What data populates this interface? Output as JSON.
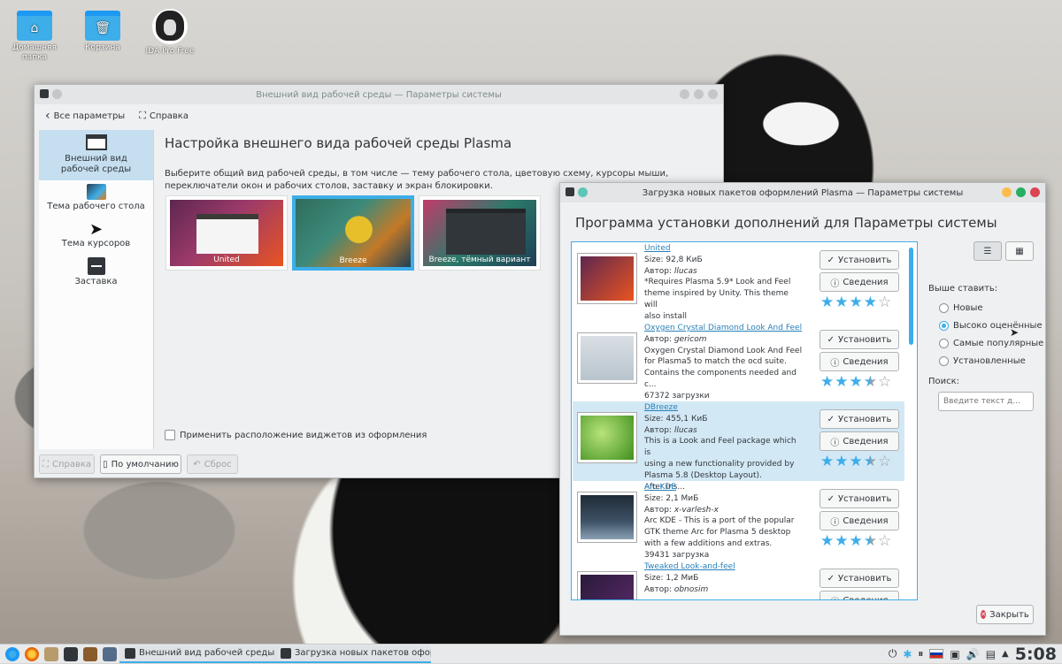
{
  "desktop": {
    "icons": [
      {
        "label": "Домашняя папка"
      },
      {
        "label": "Корзина"
      },
      {
        "label": "IDA Pro Free"
      }
    ]
  },
  "window1": {
    "title": "Внешний вид рабочей среды — Параметры системы",
    "toolbar": {
      "back_label": "Все параметры",
      "help_label": "Справка"
    },
    "sidebar": {
      "items": [
        {
          "label": "Внешний вид рабочей среды",
          "icon": "window-icon"
        },
        {
          "label": "Тема рабочего стола",
          "icon": "desktop-theme-icon"
        },
        {
          "label": "Тема курсоров",
          "icon": "cursor-icon"
        },
        {
          "label": "Заставка",
          "icon": "splash-icon"
        }
      ]
    },
    "heading": "Настройка внешнего вида рабочей среды Plasma",
    "description": "Выберите общий вид рабочей среды, в том числе — тему рабочего стола, цветовую схему, курсоры мыши, переключатели окон и рабочих столов, заставку и экран блокировки.",
    "themes": [
      {
        "label": "United"
      },
      {
        "label": "Breeze"
      },
      {
        "label": "Breeze, тёмный вариант"
      }
    ],
    "checkbox_label": "Применить расположение виджетов из оформления",
    "buttons": {
      "help": "Справка",
      "defaults": "По умолчанию",
      "reset": "Сброс"
    }
  },
  "window2": {
    "title": "Загрузка новых пакетов оформлений Plasma — Параметры системы",
    "heading": "Программа установки дополнений для Параметры системы",
    "install_label": "Установить",
    "details_label": "Сведения",
    "items": [
      {
        "name": "United",
        "line1": "Size: 92,8 КиБ",
        "author_prefix": "Автор: ",
        "author": "llucas",
        "line3": "*Requires Plasma 5.9* Look and Feel",
        "line4": "theme inspired by Unity. This theme will",
        "line5": "also install",
        "line6": "",
        "rating": 4
      },
      {
        "name": "Oxygen Crystal Diamond Look And Feel",
        "line1": "",
        "author_prefix": "Автор: ",
        "author": "gericom",
        "line3": "Oxygen Crystal Diamond Look And Feel",
        "line4": "for Plasma5 to match the ocd suite.",
        "line5": " Contains the components needed and",
        "line6": "c...",
        "downloads": "67372 загрузки",
        "rating": 3.5
      },
      {
        "name": "DBreeze",
        "line1": "Size: 455,1 КиБ",
        "author_prefix": "Автор: ",
        "author": "llucas",
        "line3": "This is a Look and Feel package which is",
        "line4": "using a new functionality provided by",
        "line5": "Plasma 5.8 (Desktop Layout).",
        "line6": " After ins...",
        "rating": 3.5
      },
      {
        "name": "Arc KDE",
        "line1": "Size: 2,1 МиБ",
        "author_prefix": "Автор: ",
        "author": "x-varlesh-x",
        "line3": "Arc KDE - This is a port of the popular",
        "line4": "GTK theme Arc for Plasma 5 desktop",
        "line5": "with a few additions and extras.",
        "line6": "39431 загрузка",
        "rating": 3.5
      },
      {
        "name": "Tweaked Look-and-feel",
        "line1": "Size: 1,2 МиБ",
        "author_prefix": "Автор: ",
        "author": "obnosim",
        "line3": "",
        "line4": "",
        "line5": "",
        "line6": "",
        "rating": 0
      }
    ],
    "sort": {
      "label": "Выше ставить:",
      "options": [
        "Новые",
        "Высоко оценённые",
        "Самые популярные",
        "Установленные"
      ],
      "selected_index": 1
    },
    "search": {
      "label": "Поиск:",
      "placeholder": "Введите текст д..."
    },
    "close_label": "Закрыть"
  },
  "taskbar": {
    "tasks": [
      {
        "label": "Внешний вид рабочей среды —..."
      },
      {
        "label": "Загрузка новых пакетов оформл..."
      }
    ],
    "clock": "5:08"
  },
  "colors": {
    "accent": "#3daee9",
    "link": "#2980b9"
  }
}
